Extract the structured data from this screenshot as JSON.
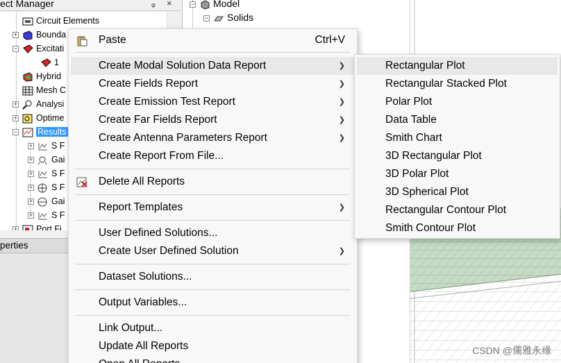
{
  "project_manager": {
    "title": "ect Manager",
    "pin": "ᵩ",
    "close": "×",
    "items": [
      {
        "label": "Circuit Elements"
      },
      {
        "label": "Bounda"
      },
      {
        "label": "Excitati"
      },
      {
        "label": "1"
      },
      {
        "label": "Hybrid"
      },
      {
        "label": "Mesh C"
      },
      {
        "label": "Analysi"
      },
      {
        "label": "Optime"
      },
      {
        "label": "Results"
      },
      {
        "label": "S F"
      },
      {
        "label": "Gai"
      },
      {
        "label": "S F"
      },
      {
        "label": "S F"
      },
      {
        "label": "Gai"
      },
      {
        "label": "S F"
      },
      {
        "label": "Port Fi"
      }
    ]
  },
  "properties": {
    "title": "perties"
  },
  "model_tree": {
    "items": [
      {
        "label": "Model"
      },
      {
        "label": "Solids"
      }
    ]
  },
  "context_menu": {
    "items": [
      {
        "label": "Paste",
        "shortcut": "Ctrl+V"
      },
      {
        "label": "Create Modal Solution Data Report"
      },
      {
        "label": "Create Fields Report"
      },
      {
        "label": "Create Emission Test Report"
      },
      {
        "label": "Create Far Fields Report"
      },
      {
        "label": "Create Antenna Parameters Report"
      },
      {
        "label": "Create Report From File..."
      },
      {
        "label": "Delete All Reports"
      },
      {
        "label": "Report Templates"
      },
      {
        "label": "User Defined Solutions..."
      },
      {
        "label": "Create User Defined Solution"
      },
      {
        "label": "Dataset Solutions..."
      },
      {
        "label": "Output Variables..."
      },
      {
        "label": "Link Output..."
      },
      {
        "label": "Update All Reports"
      },
      {
        "label": "Open All Reports"
      }
    ],
    "submenu_arrow": "❯"
  },
  "submenu": {
    "items": [
      {
        "label": "Rectangular Plot"
      },
      {
        "label": "Rectangular Stacked Plot"
      },
      {
        "label": "Polar Plot"
      },
      {
        "label": "Data Table"
      },
      {
        "label": "Smith Chart"
      },
      {
        "label": "3D Rectangular Plot"
      },
      {
        "label": "3D Polar Plot"
      },
      {
        "label": "3D Spherical Plot"
      },
      {
        "label": "Rectangular Contour Plot"
      },
      {
        "label": "Smith Contour Plot"
      }
    ]
  },
  "watermark": "CSDN @儒雅永缘",
  "colors": {
    "selection": "#3399ff",
    "menu_bg": "#f8f8f8",
    "menu_highlight": "#e8e8e8",
    "solid_green": "#c5dbc3"
  }
}
